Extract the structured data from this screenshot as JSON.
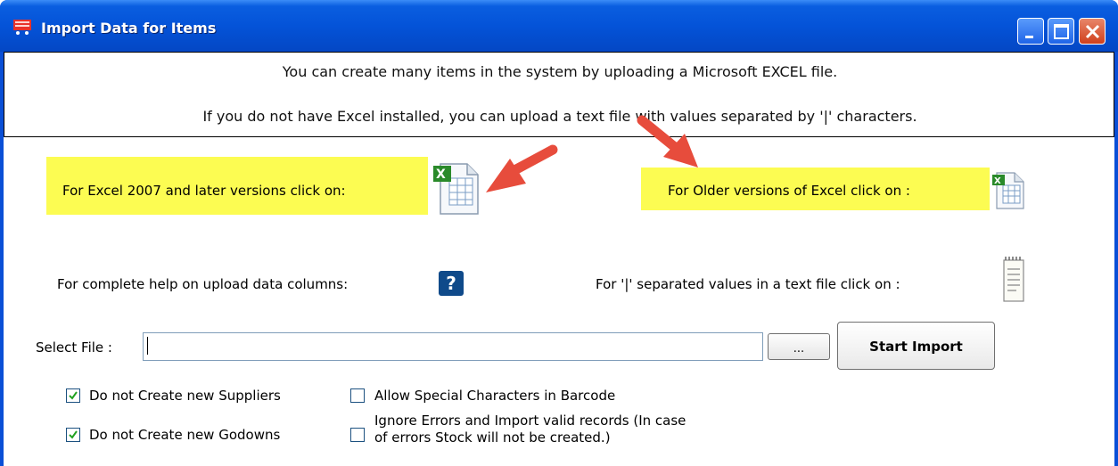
{
  "window": {
    "title": "Import Data for Items",
    "controls": {
      "minimize": "minimize",
      "maximize": "maximize",
      "close": "close"
    }
  },
  "banner": {
    "line1": "You can create many items in the system by uploading a Microsoft EXCEL file.",
    "line2": "If you do not have Excel installed, you can upload a text file with values separated by '|' characters."
  },
  "excel_new": {
    "label": "For Excel 2007 and later versions click on:",
    "icon": "excel-xlsx-icon"
  },
  "excel_old": {
    "label": "For Older versions of Excel click on :",
    "icon": "excel-xls-icon"
  },
  "help": {
    "label": "For complete help on upload data columns:",
    "icon": "help-question-icon",
    "glyph": "?"
  },
  "text_file": {
    "label": "For '|' separated  values in a text file click on :",
    "icon": "text-file-icon"
  },
  "file_select": {
    "label": "Select File :",
    "value": "",
    "browse_label": "...",
    "start_label": "Start Import"
  },
  "options": {
    "no_new_suppliers": {
      "label": "Do not Create new Suppliers",
      "checked": true
    },
    "special_chars_barcode": {
      "label": "Allow Special Characters in Barcode",
      "checked": false
    },
    "no_new_godowns": {
      "label": "Do not Create new Godowns",
      "checked": true
    },
    "ignore_errors": {
      "label_line1": "Ignore Errors and Import valid records (In case",
      "label_line2": "of errors Stock will not be created.)",
      "checked": false
    }
  },
  "colors": {
    "title_bar": "#0453d8",
    "highlight": "#fcfc52",
    "arrow": "#e74c3c",
    "help_icon": "#0f4a8a"
  }
}
